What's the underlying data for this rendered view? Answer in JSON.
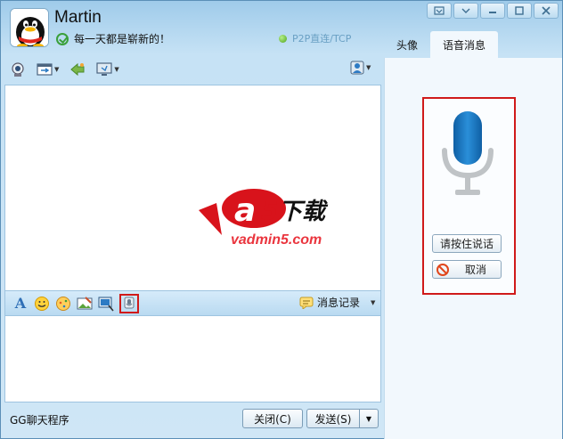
{
  "header": {
    "contact_name": "Martin",
    "signature": "每一天都是崭新的！",
    "connection": "P2P直连/TCP"
  },
  "window_controls": [
    "skin",
    "menu",
    "minimize",
    "maximize",
    "close"
  ],
  "toolbar": {
    "icons": [
      "camera-icon",
      "file-transfer-icon",
      "app-share-icon",
      "screen-share-icon",
      "contact-card-icon"
    ]
  },
  "input_toolbar": {
    "icons": [
      "font-icon",
      "emoji-icon",
      "magic-emoji-icon",
      "image-icon",
      "screenshot-icon",
      "voice-message-icon"
    ],
    "font_label": "A",
    "history_label": "消息记录"
  },
  "logo": {
    "brand": "a5下载",
    "url": "admin5.com"
  },
  "footer": {
    "app_label": "GG聊天程序",
    "close_label": "关闭(C)",
    "send_label": "发送(S)"
  },
  "right_panel": {
    "tabs": [
      {
        "label": "头像",
        "active": false
      },
      {
        "label": "语音消息",
        "active": true
      }
    ],
    "hold_to_talk_label": "请按住说话",
    "cancel_label": "取消"
  },
  "colors": {
    "accent_red": "#d01a1a",
    "mic_blue": "#1a78c2",
    "window_blue": "#b9d8ef"
  }
}
